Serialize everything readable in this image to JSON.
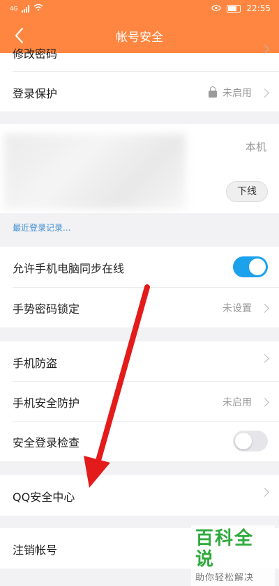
{
  "status_bar": {
    "time": "22:55",
    "network": "4G"
  },
  "header": {
    "title": "帐号安全"
  },
  "rows": {
    "change_password": "修改密码",
    "login_protection": {
      "label": "登录保护",
      "value": "未启用"
    },
    "device_this": "本机",
    "offline_button": "下线",
    "recent_login_link": "最近登录记录...",
    "sync_online": "允许手机电脑同步在线",
    "gesture_lock": {
      "label": "手势密码锁定",
      "value": "未设置"
    },
    "phone_antitheft": "手机防盗",
    "phone_protection": {
      "label": "手机安全防护",
      "value": "未启用"
    },
    "safe_login_check": "安全登录检查",
    "qq_security_center": "QQ安全中心",
    "cancel_account": "注销帐号"
  },
  "toggles": {
    "sync_online": true,
    "safe_login_check": false
  },
  "watermark": {
    "title": "百科全说",
    "subtitle": "助你轻松解决"
  },
  "colors": {
    "header": "#ff8640",
    "toggle_on": "#1ca1ec",
    "arrow": "#e31b1b",
    "watermark": "#2eaa3c"
  }
}
